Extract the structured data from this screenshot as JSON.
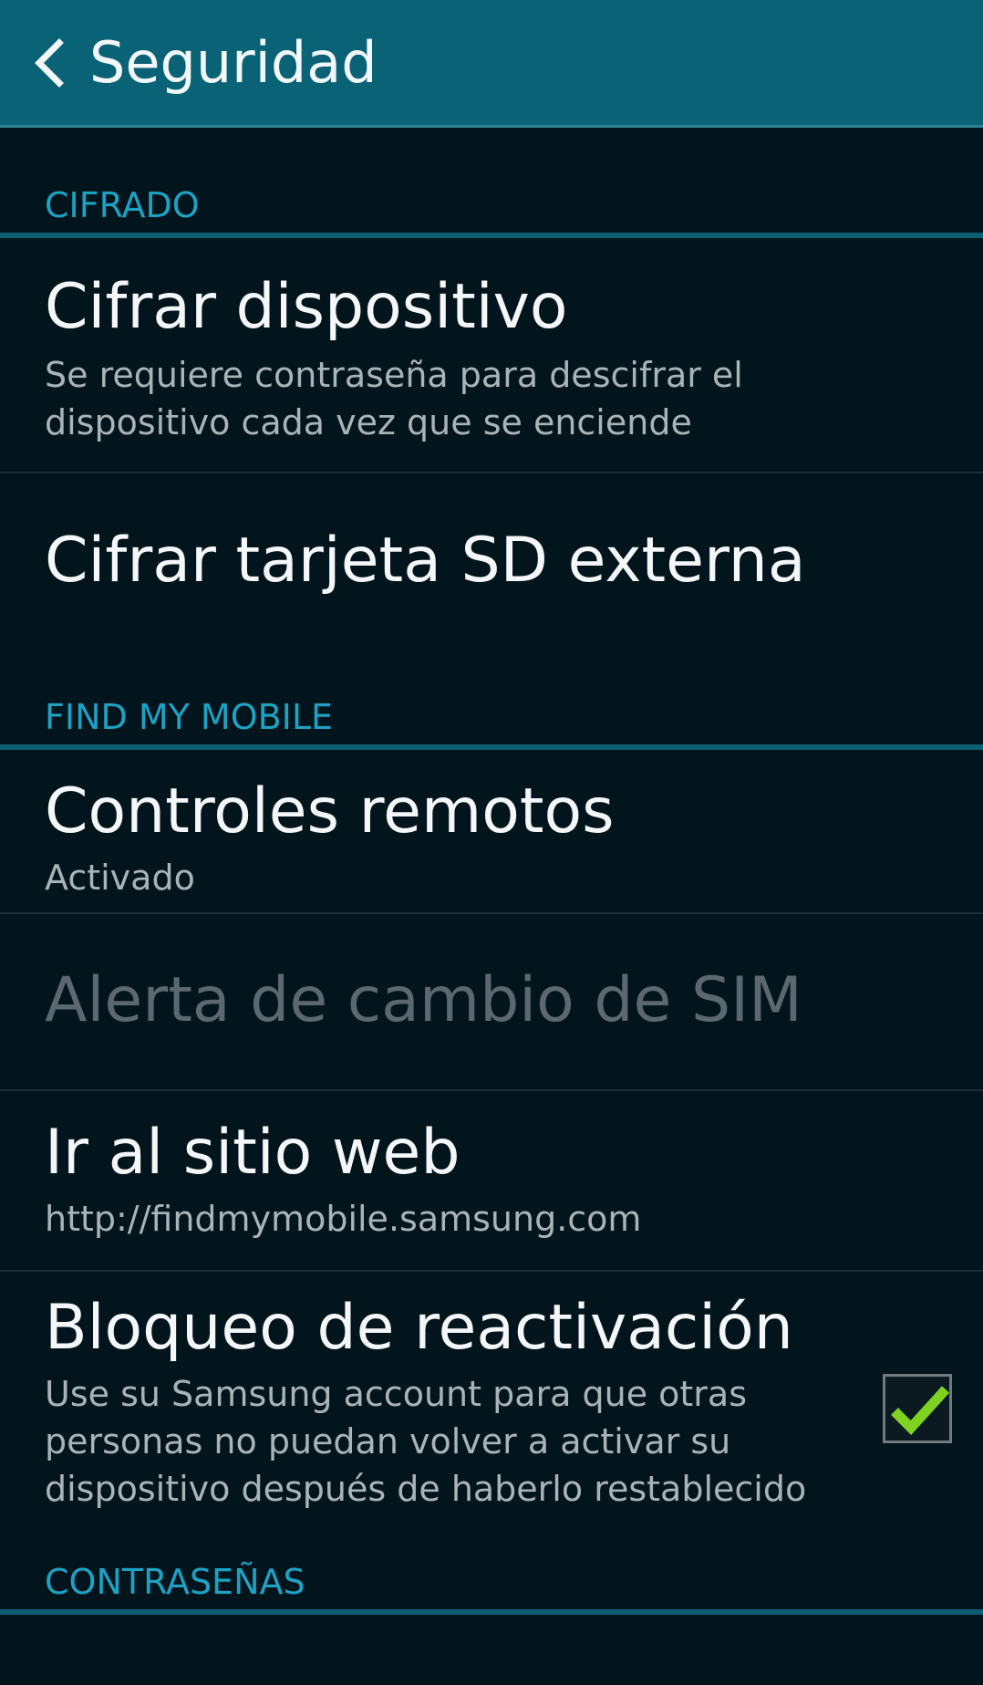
{
  "action_bar": {
    "title": "Seguridad",
    "background": "#0a6277"
  },
  "sections": {
    "encryption": {
      "header": "CIFRADO",
      "items": [
        {
          "title": "Cifrar dispositivo",
          "summary": "Se requiere contraseña para descifrar el dispositivo cada vez que se enciende"
        },
        {
          "title": "Cifrar tarjeta SD externa"
        }
      ]
    },
    "find_my_mobile": {
      "header": "FIND MY MOBILE",
      "items": [
        {
          "title": "Controles remotos",
          "summary": "Activado"
        },
        {
          "title": "Alerta de cambio de SIM",
          "enabled": false
        },
        {
          "title": "Ir al sitio web",
          "summary": "http://findmymobile.samsung.com"
        },
        {
          "title": "Bloqueo de reactivación",
          "summary": "Use su Samsung account para que otras personas no puedan volver a activar su dispositivo después de haberlo restablecido",
          "checked": true
        }
      ]
    },
    "passwords": {
      "header": "CONTRASEÑAS"
    }
  },
  "colors": {
    "accent": "#1da2c4",
    "background": "#02141c",
    "check": "#7ed321"
  },
  "icons": {
    "back": "back-arrow-icon",
    "check": "checkmark-icon"
  }
}
